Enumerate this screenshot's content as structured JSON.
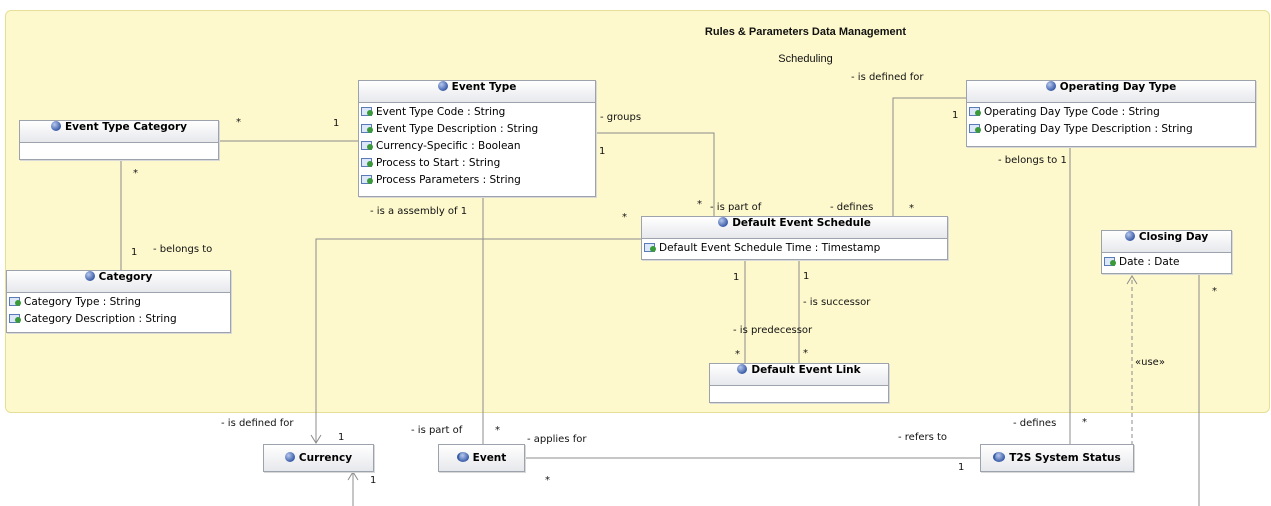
{
  "package": {
    "title": "Rules & Parameters Data Management",
    "subtitle": "Scheduling"
  },
  "classes": {
    "event_type_category": {
      "name": "Event Type Category",
      "attributes": []
    },
    "category": {
      "name": "Category",
      "attributes": [
        "Category Type : String",
        "Category Description : String"
      ]
    },
    "event_type": {
      "name": "Event Type",
      "attributes": [
        "Event Type Code : String",
        "Event Type Description : String",
        "Currency-Specific : Boolean",
        "Process to Start : String",
        "Process Parameters : String"
      ]
    },
    "operating_day_type": {
      "name": "Operating Day Type",
      "attributes": [
        "Operating Day Type Code : String",
        "Operating Day Type Description : String"
      ]
    },
    "default_event_schedule": {
      "name": "Default Event Schedule",
      "attributes": [
        "Default Event Schedule Time : Timestamp"
      ]
    },
    "closing_day": {
      "name": "Closing Day",
      "attributes": [
        "Date : Date"
      ]
    },
    "default_event_link": {
      "name": "Default Event Link",
      "attributes": []
    },
    "currency": {
      "name": "Currency",
      "attributes": []
    },
    "event": {
      "name": "Event",
      "attributes": []
    },
    "t2s_system_status": {
      "name": "T2S System Status",
      "attributes": []
    }
  },
  "labels": {
    "etc_star": "*",
    "et_one_left": "1",
    "groups": "- groups",
    "groups_one": "1",
    "etc_bottom_star": "*",
    "belongs_to": "- belongs to",
    "belongs_to_one": "1",
    "is_assembly_of": "- is a assembly of 1",
    "is_part_of": "- is part of",
    "is_part_of_star": "*",
    "des_left_star": "*",
    "defines": "- defines",
    "defines_star": "*",
    "is_defined_for_top": "- is defined for",
    "odt_one": "1",
    "odt_belongs_to": "- belongs to 1",
    "des_one_a": "1",
    "des_one_b": "1",
    "is_successor": "- is successor",
    "is_predecessor": "- is predecessor",
    "del_star_a": "*",
    "del_star_b": "*",
    "use": "«use»",
    "cd_star": "*",
    "is_defined_for": "- is defined for",
    "currency_one": "1",
    "currency_one_b": "1",
    "event_is_part_of": "- is part of",
    "event_star": "*",
    "applies_for": "- applies for",
    "event_bottom_star": "*",
    "refers_to": "- refers to",
    "t2s_one": "1",
    "t2s_defines": "- defines",
    "t2s_defines_star": "*"
  }
}
